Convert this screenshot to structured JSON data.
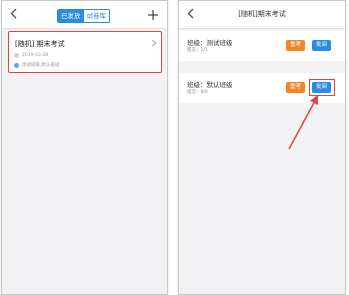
{
  "left": {
    "segmented": {
      "tab_published": "已发放",
      "tab_library": "试卷库"
    },
    "exam": {
      "title": "[随机] 期末考试",
      "date": "2019-03-28",
      "classes": "测试班级,默认班级"
    }
  },
  "right": {
    "title": "[随机]期末考试",
    "classes": [
      {
        "name": "班级：测试班级",
        "submitted": "提交：1/1",
        "reexam_label": "重考",
        "grade_label": "批阅"
      },
      {
        "name": "班级：默认班级",
        "submitted": "提交：0/0",
        "reexam_label": "重考",
        "grade_label": "批阅"
      }
    ]
  },
  "colors": {
    "accent": "#2a8ae6",
    "reexam": "#f0882a",
    "highlight": "#e1443e"
  }
}
